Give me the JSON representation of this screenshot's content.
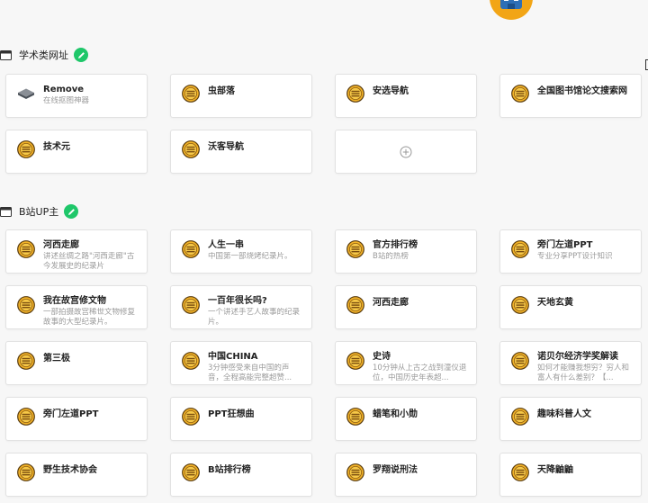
{
  "sections": [
    {
      "title": "学术类网址",
      "items": [
        {
          "title": "Remove",
          "desc": "在线抠图神器",
          "icon": "stack-icon"
        },
        {
          "title": "虫部落",
          "desc": "",
          "icon": "coin-icon"
        },
        {
          "title": "安选导航",
          "desc": "",
          "icon": "coin-icon"
        },
        {
          "title": "全国图书馆论文搜索网",
          "desc": "",
          "icon": "coin-icon"
        },
        {
          "title": "技术元",
          "desc": "",
          "icon": "coin-icon"
        },
        {
          "title": "沃客导航",
          "desc": "",
          "icon": "coin-icon"
        }
      ]
    },
    {
      "title": "B站UP主",
      "items": [
        {
          "title": "河西走廊",
          "desc": "讲述丝绸之路\"河西走廊\"古今发展史的纪录片",
          "icon": "coin-icon"
        },
        {
          "title": "人生一串",
          "desc": "中国第一部烧烤纪录片。",
          "icon": "coin-icon"
        },
        {
          "title": "官方排行榜",
          "desc": "B站的热榜",
          "icon": "coin-icon"
        },
        {
          "title": "旁门左道PPT",
          "desc": "专业分享PPT设计知识",
          "icon": "coin-icon"
        },
        {
          "title": "我在故宫修文物",
          "desc": "一部拍摄故宫稀世文物修复故事的大型纪录片。",
          "icon": "coin-icon"
        },
        {
          "title": "一百年很长吗?",
          "desc": "一个讲述手艺人故事的纪录片。",
          "icon": "coin-icon"
        },
        {
          "title": "河西走廊",
          "desc": "",
          "icon": "coin-icon"
        },
        {
          "title": "天地玄黄",
          "desc": "",
          "icon": "coin-icon"
        },
        {
          "title": "第三极",
          "desc": "",
          "icon": "coin-icon"
        },
        {
          "title": "中国CHINA",
          "desc": "3分钟感受来自中国的声音，全程高能完整超赞...",
          "icon": "coin-icon"
        },
        {
          "title": "史诗",
          "desc": "10分钟从上古之战到潼仪退位，中国历史年表超...",
          "icon": "coin-icon"
        },
        {
          "title": "诺贝尔经济学奖解读",
          "desc": "如何才能赚我想穷？穷人和富人有什么差别？【...",
          "icon": "coin-icon"
        },
        {
          "title": "旁门左道PPT",
          "desc": "",
          "icon": "coin-icon"
        },
        {
          "title": "PPT狂想曲",
          "desc": "",
          "icon": "coin-icon"
        },
        {
          "title": "蜡笔和小勋",
          "desc": "",
          "icon": "coin-icon"
        },
        {
          "title": "趣味科普人文",
          "desc": "",
          "icon": "coin-icon"
        },
        {
          "title": "野生技术协会",
          "desc": "",
          "icon": "coin-icon"
        },
        {
          "title": "B站排行榜",
          "desc": "",
          "icon": "coin-icon"
        },
        {
          "title": "罗翔说刑法",
          "desc": "",
          "icon": "coin-icon"
        },
        {
          "title": "天降鼬鼬",
          "desc": "",
          "icon": "coin-icon"
        }
      ]
    }
  ],
  "add_icon": "plus-circle-icon",
  "colors": {
    "accent": "#1fc76a",
    "coin": "#f2b227",
    "mascot": "#f2a516"
  }
}
